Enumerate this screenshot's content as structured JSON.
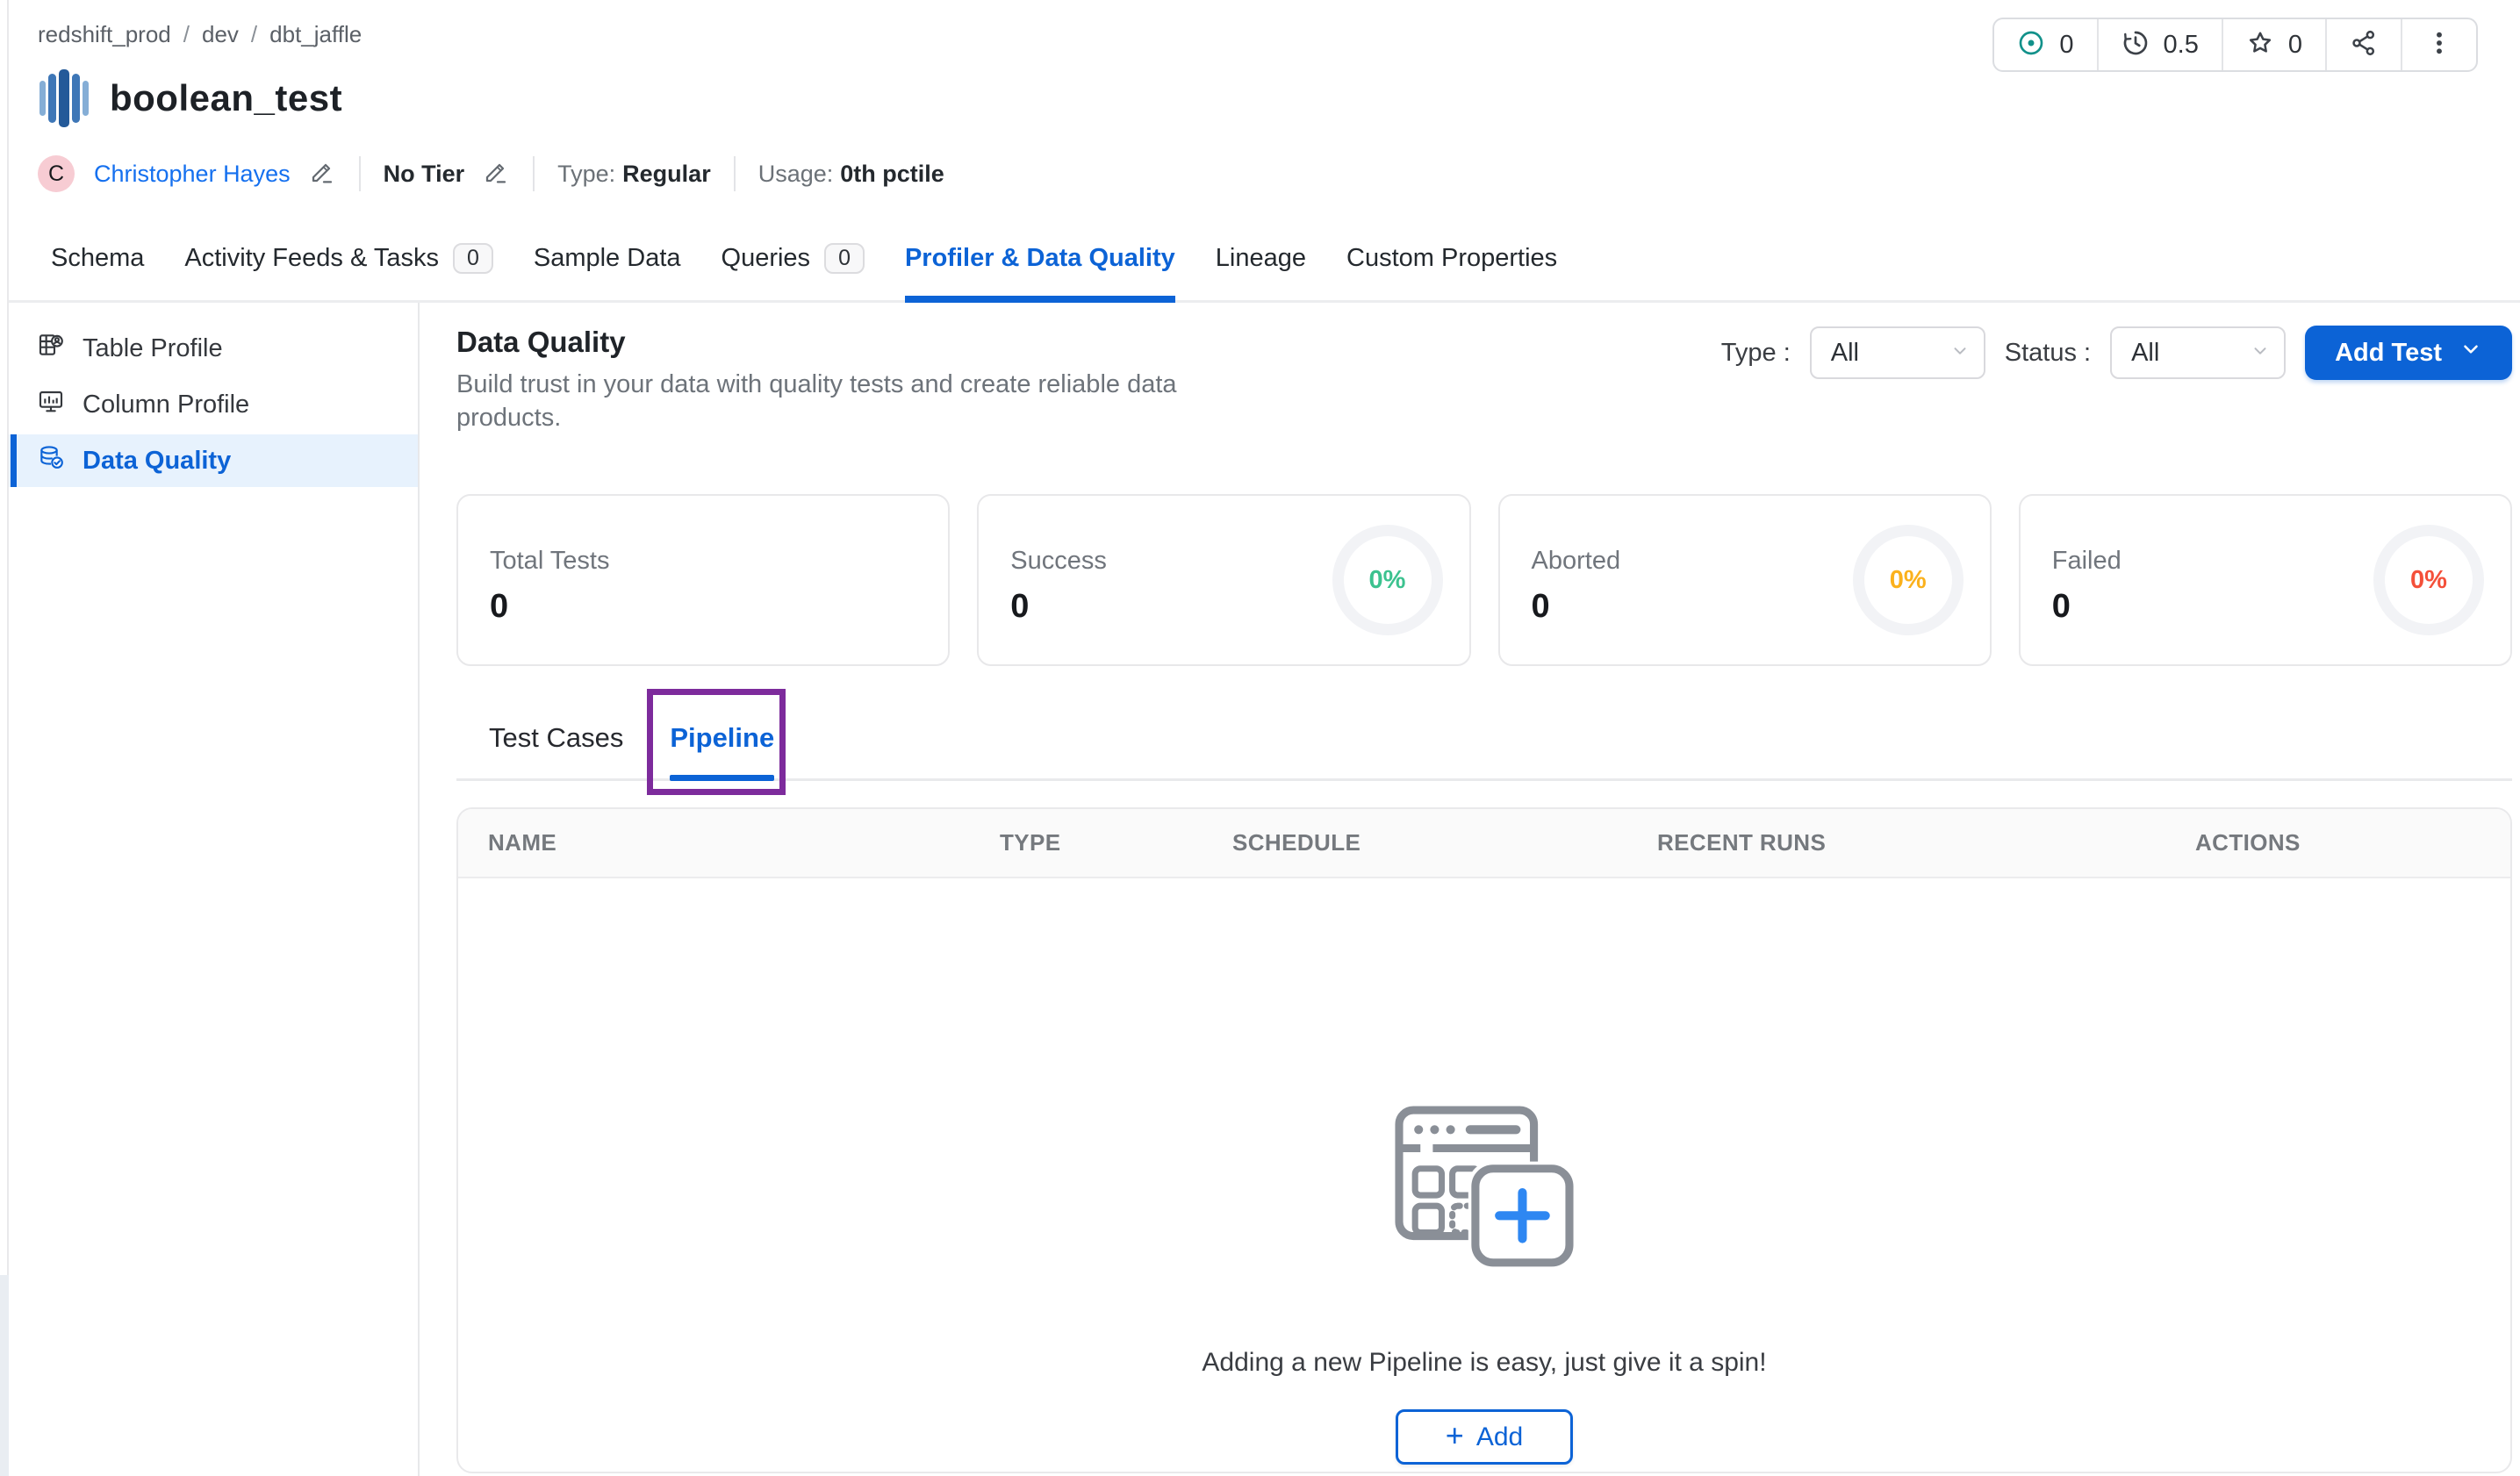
{
  "breadcrumb": {
    "separator": "/",
    "items": [
      "redshift_prod",
      "dev",
      "dbt_jaffle"
    ]
  },
  "header": {
    "title": "boolean_test",
    "owner": {
      "initial": "C",
      "name": "Christopher Hayes"
    },
    "tier_label": "No Tier",
    "type_label": "Type:",
    "type_value": "Regular",
    "usage_label": "Usage:",
    "usage_value": "0th pctile",
    "stats": {
      "conversations": "0",
      "version": "0.5",
      "stars": "0"
    }
  },
  "tabs": [
    {
      "label": "Schema"
    },
    {
      "label": "Activity Feeds & Tasks",
      "badge": "0"
    },
    {
      "label": "Sample Data"
    },
    {
      "label": "Queries",
      "badge": "0"
    },
    {
      "label": "Profiler & Data Quality"
    },
    {
      "label": "Lineage"
    },
    {
      "label": "Custom Properties"
    }
  ],
  "sidebar": {
    "items": [
      {
        "label": "Table Profile"
      },
      {
        "label": "Column Profile"
      },
      {
        "label": "Data Quality"
      }
    ]
  },
  "main": {
    "heading": "Data Quality",
    "description": "Build trust in your data with quality tests and create reliable data products.",
    "filters": {
      "type_label": "Type :",
      "type_value": "All",
      "status_label": "Status :",
      "status_value": "All"
    },
    "add_test_label": "Add Test",
    "summary_cards": [
      {
        "label": "Total Tests",
        "value": "0"
      },
      {
        "label": "Success",
        "value": "0",
        "percent": "0%",
        "color": "#3cc28f"
      },
      {
        "label": "Aborted",
        "value": "0",
        "percent": "0%",
        "color": "#fbb11c"
      },
      {
        "label": "Failed",
        "value": "0",
        "percent": "0%",
        "color": "#f4503a"
      }
    ],
    "sub_tabs": [
      {
        "label": "Test Cases"
      },
      {
        "label": "Pipeline"
      }
    ],
    "table": {
      "columns": [
        "NAME",
        "TYPE",
        "SCHEDULE",
        "RECENT RUNS",
        "ACTIONS"
      ]
    },
    "empty_state": {
      "message": "Adding a new Pipeline is easy, just give it a spin!",
      "add_label": "Add"
    }
  },
  "colors": {
    "primary": "#0c63d6",
    "annotation": "#7d2b9c"
  }
}
